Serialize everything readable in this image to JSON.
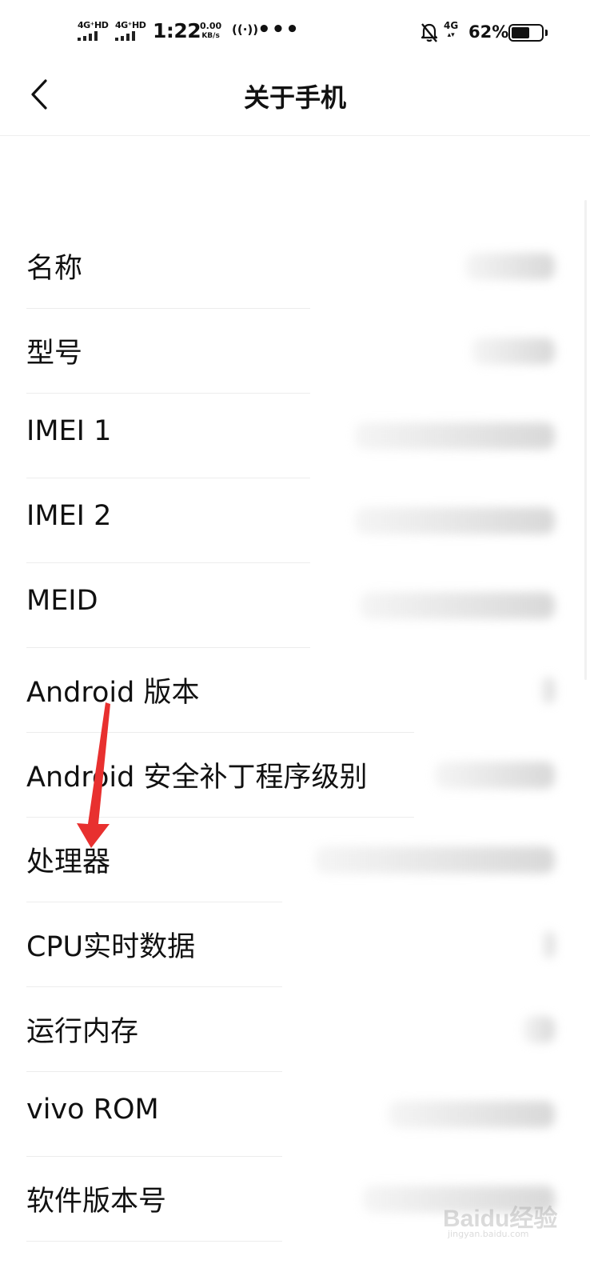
{
  "status_bar": {
    "sim1_label": "4G⁺HD",
    "sim2_label": "4G⁺HD",
    "time": "1:22",
    "net_speed_value": "0.00",
    "net_speed_unit": "KB/s",
    "hotspot_glyph": "((·))",
    "more_glyph": "•••",
    "mobile_data_label": "4G",
    "battery_percent": "62%",
    "battery_level": 0.62,
    "icons": [
      "signal-icon",
      "hotspot-icon",
      "bell-off-icon",
      "battery-icon"
    ]
  },
  "nav": {
    "title": "关于手机",
    "back_icon": "chevron-left-icon"
  },
  "rows": [
    {
      "label": "名称"
    },
    {
      "label": "型号"
    },
    {
      "label": "IMEI 1"
    },
    {
      "label": "IMEI 2"
    },
    {
      "label": "MEID"
    },
    {
      "label": "Android 版本"
    },
    {
      "label": "Android 安全补丁程序级别"
    },
    {
      "label": "处理器"
    },
    {
      "label": "CPU实时数据"
    },
    {
      "label": "运行内存"
    },
    {
      "label": "vivo ROM"
    },
    {
      "label": "软件版本号"
    }
  ],
  "annotation": {
    "color": "#e8302f"
  },
  "watermark": {
    "text": "Baidu经验",
    "sub": "jingyan.baidu.com"
  }
}
